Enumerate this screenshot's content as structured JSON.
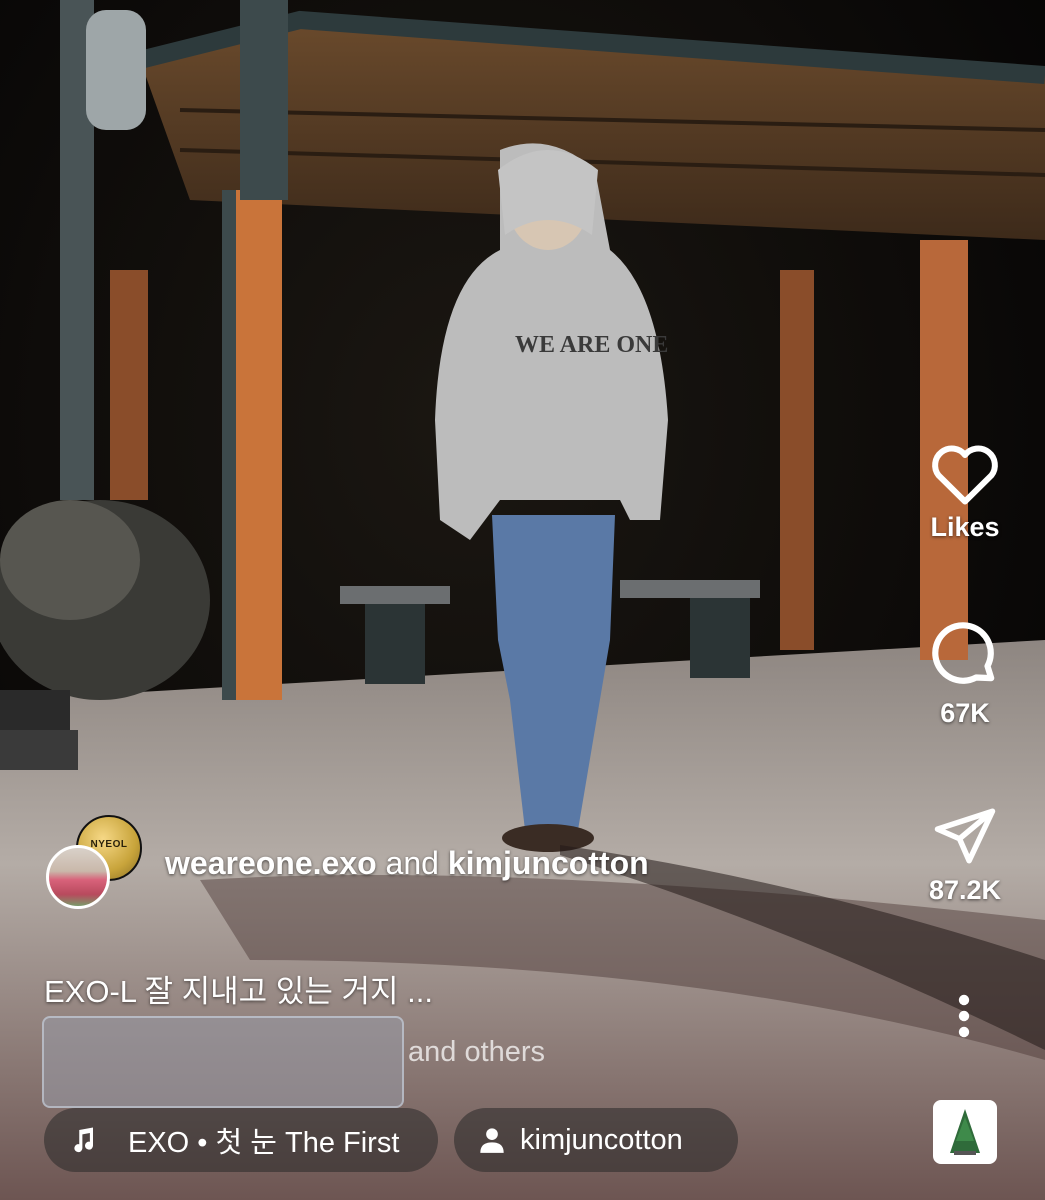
{
  "post": {
    "author_primary": "weareone.exo",
    "author_joiner": "and",
    "author_secondary": "kimjuncotton",
    "caption": "EXO-L 잘 지내고 있는 거지 ...",
    "liked_by_suffix": "and others",
    "avatar_badge_text": "NYEOL"
  },
  "actions": {
    "like_label": "Likes",
    "comment_count": "67K",
    "share_count": "87.2K"
  },
  "audio": {
    "music_label": "EXO • 첫 눈 The First",
    "user_tag": "kimjuncotton"
  },
  "icons": {
    "like": "heart-outline-icon",
    "comment": "speech-bubble-icon",
    "share": "paper-plane-icon",
    "more": "vertical-ellipsis-icon",
    "music": "music-note-icon",
    "user": "person-icon"
  },
  "colors": {
    "text": "#ffffff",
    "pill_bg": "#282828",
    "liked_box": "#9696a0"
  }
}
